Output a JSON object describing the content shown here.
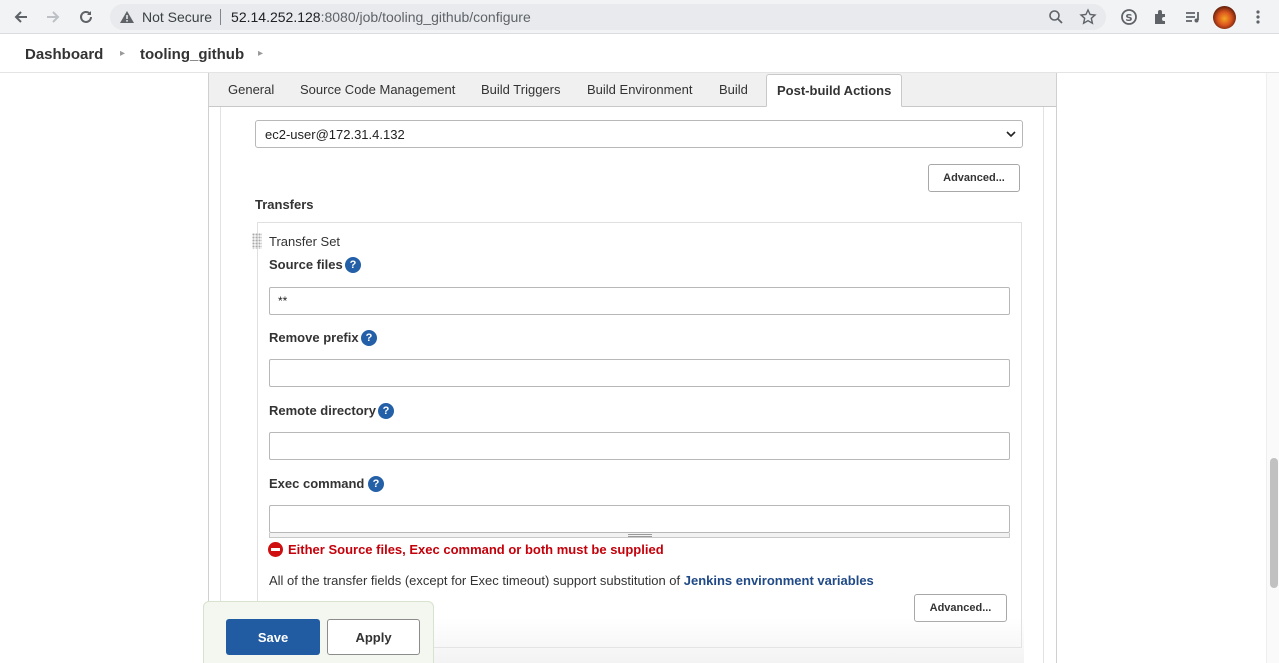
{
  "browser": {
    "security_label": "Not Secure",
    "url_host": "52.14.252.128",
    "url_rest": ":8080/job/tooling_github/configure",
    "icons": [
      "back-icon",
      "forward-icon",
      "reload-icon",
      "warning-icon",
      "zoom-icon",
      "star-icon",
      "skype-icon",
      "extensions-icon",
      "media-queue-icon",
      "profile-avatar",
      "menu-icon"
    ]
  },
  "breadcrumb": {
    "items": [
      "Dashboard",
      "tooling_github"
    ]
  },
  "tabs": [
    "General",
    "Source Code Management",
    "Build Triggers",
    "Build Environment",
    "Build",
    "Post-build Actions"
  ],
  "active_tab": "Post-build Actions",
  "ssh_server": {
    "selected": "ec2-user@172.31.4.132",
    "advanced_label": "Advanced..."
  },
  "transfers": {
    "heading": "Transfers",
    "set_title": "Transfer Set",
    "source_files_label": "Source files",
    "source_files_value": "**",
    "remove_prefix_label": "Remove prefix",
    "remove_prefix_value": "",
    "remote_directory_label": "Remote directory",
    "remote_directory_value": "",
    "exec_command_label": "Exec command",
    "exec_command_value": "",
    "error": "Either Source files, Exec command or both must be supplied",
    "note_text": "All of the transfer fields (except for Exec timeout) support substitution of ",
    "note_link": "Jenkins environment variables",
    "advanced_label": "Advanced...",
    "help_glyph": "?"
  },
  "footer": {
    "save_label": "Save",
    "apply_label": "Apply"
  },
  "colors": {
    "save": "#215ba1",
    "error": "#c4000a",
    "link": "#204a87",
    "help": "#2460a7"
  }
}
